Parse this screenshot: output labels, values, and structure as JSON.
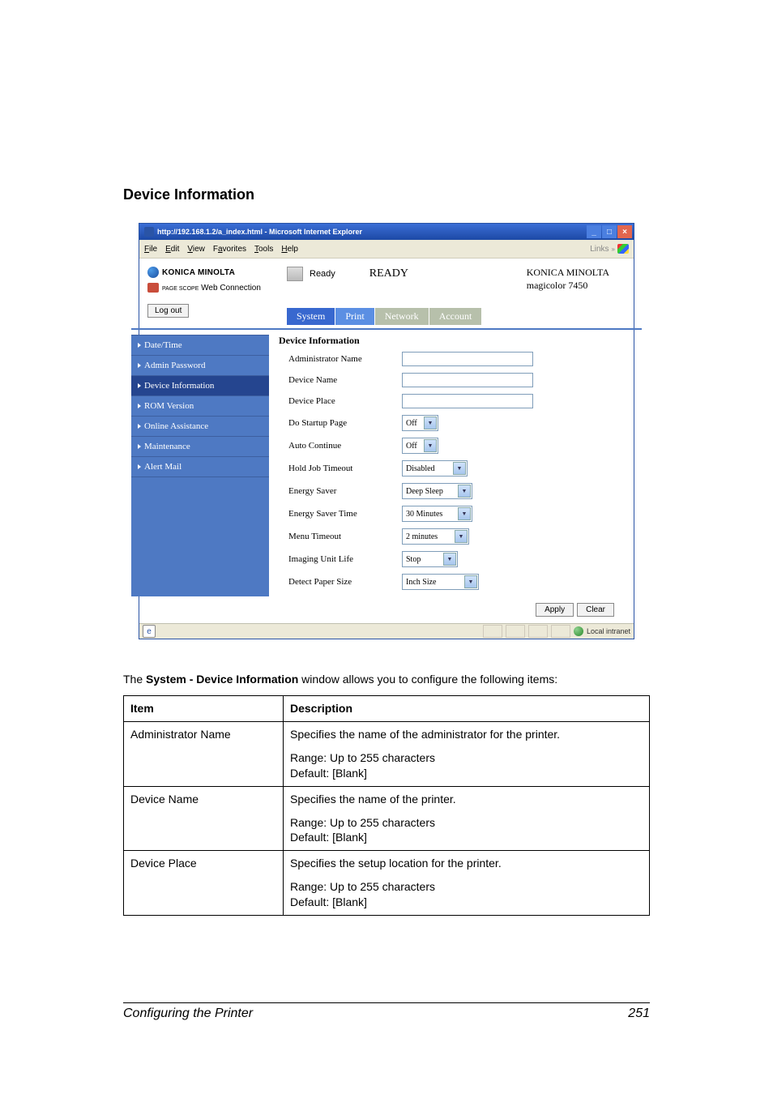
{
  "page": {
    "heading": "Device Information",
    "paragraph_prefix": "The ",
    "paragraph_bold": "System - Device Information",
    "paragraph_suffix": " window allows you to configure the following items:",
    "footer_left": "Configuring the Printer",
    "footer_right": "251"
  },
  "ie": {
    "title": "http://192.168.1.2/a_index.html - Microsoft Internet Explorer",
    "menus": {
      "file": "File",
      "edit": "Edit",
      "view": "View",
      "favorites": "Favorites",
      "tools": "Tools",
      "help": "Help"
    },
    "links": "Links",
    "status_zone": "Local intranet"
  },
  "brand": {
    "km": "KONICA MINOLTA",
    "webconn_prefix": "PAGE SCOPE",
    "webconn": " Web Connection",
    "logout": "Log out"
  },
  "ready": {
    "small": "Ready",
    "big": "READY",
    "right1": "KONICA MINOLTA",
    "right2": "magicolor 7450"
  },
  "tabs": {
    "system": "System",
    "print": "Print",
    "network": "Network",
    "account": "Account"
  },
  "sidebar": {
    "items": [
      "Date/Time",
      "Admin Password",
      "Device Information",
      "ROM Version",
      "Online Assistance",
      "Maintenance",
      "Alert Mail"
    ]
  },
  "form": {
    "title": "Device Information",
    "rows": {
      "admin_name": "Administrator Name",
      "device_name": "Device Name",
      "device_place": "Device Place",
      "startup": "Do Startup Page",
      "auto_cont": "Auto Continue",
      "hold_job": "Hold Job Timeout",
      "energy_saver": "Energy Saver",
      "energy_time": "Energy Saver Time",
      "menu_timeout": "Menu Timeout",
      "imaging": "Imaging Unit Life",
      "detect": "Detect Paper Size"
    },
    "vals": {
      "off": "Off",
      "disabled": "Disabled",
      "deep": "Deep Sleep",
      "t30": "30 Minutes",
      "t2": "2 minutes",
      "stop": "Stop",
      "inch": "Inch Size"
    },
    "apply": "Apply",
    "clear": "Clear"
  },
  "table": {
    "head_item": "Item",
    "head_desc": "Description",
    "rows": [
      {
        "item": "Administrator Name",
        "desc1": "Specifies the name of the administrator for the printer.",
        "range": "Range:   Up to 255 characters",
        "default": "Default:   [Blank]"
      },
      {
        "item": "Device Name",
        "desc1": "Specifies the name of the printer.",
        "range": "Range:   Up to 255 characters",
        "default": "Default:   [Blank]"
      },
      {
        "item": "Device Place",
        "desc1": "Specifies the setup location for the printer.",
        "range": "Range:   Up to 255 characters",
        "default": "Default:   [Blank]"
      }
    ]
  }
}
